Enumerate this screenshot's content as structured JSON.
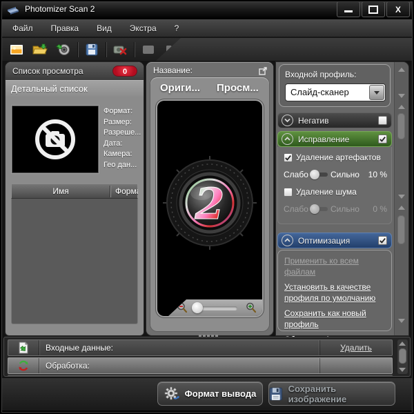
{
  "window": {
    "title": "Photomizer Scan 2",
    "close_glyph": "X"
  },
  "menu": {
    "items": [
      "Файл",
      "Правка",
      "Вид",
      "Экстра",
      "?"
    ]
  },
  "toolbar": {
    "icons": [
      "image",
      "open-folder",
      "scan-import",
      "save",
      "delete-image",
      "view-single",
      "view-dual"
    ]
  },
  "left_panel": {
    "tab_label": "Список просмотра",
    "badge_count": "0",
    "subheader": "Детальный список",
    "metadata_labels": [
      "Формат:",
      "Размер:",
      "Разреше...",
      "Дата:",
      "Камера:",
      "Гео дан..."
    ],
    "list_columns": [
      "Имя",
      "Формат"
    ]
  },
  "center_panel": {
    "title_label": "Название:",
    "tabs": [
      "Ориги...",
      "Просм..."
    ],
    "logo_digit": "2"
  },
  "right_panel": {
    "profile_label": "Входной профиль:",
    "profile_value": "Слайд-сканер",
    "sections": {
      "negative": "Негатив",
      "correction": "Исправление",
      "optimization": "Оптимизация"
    },
    "correction_controls": {
      "artifacts_label": "Удаление артефактов",
      "noise_label": "Удаление шума",
      "weak_label": "Слабо",
      "strong_label": "Сильно",
      "artifacts_value": "10 %",
      "noise_value": "0 %"
    },
    "links": [
      "Применить ко всем файлам",
      "Установить в качестве профиля по умолчанию",
      "Сохранить как новый профиль",
      "Сброс профиля до оригинального"
    ]
  },
  "bottom_panel": {
    "rows": [
      {
        "label": "Входные данные:",
        "action": "Удалить"
      },
      {
        "label": "Обработка:",
        "action": ""
      }
    ]
  },
  "footer": {
    "format_button": "Формат вывода",
    "save_button": "Сохранить изображение"
  },
  "colors": {
    "correction_green": "#3e7227",
    "optimization_blue": "#2b4a7d",
    "badge_red": "#c8102e"
  }
}
